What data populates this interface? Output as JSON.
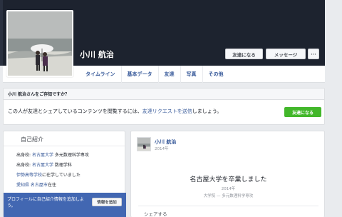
{
  "profile": {
    "name": "小川 航治"
  },
  "cover_actions": {
    "friend_button": "友達になる",
    "message_button": "メッセージ",
    "more_button": "···"
  },
  "nav": {
    "items": [
      {
        "label": "タイムライン"
      },
      {
        "label": "基本データ"
      },
      {
        "label": "友達"
      },
      {
        "label": "写真"
      },
      {
        "label": "その他"
      }
    ]
  },
  "know_card": {
    "header": "小川 航治さんをご存知ですか？",
    "body_prefix": "この人が友達とシェアしているコンテンツを閲覧するには、",
    "body_link": "友達リクエストを送信",
    "body_suffix": "しましょう。",
    "add_friend_button": "友達になる"
  },
  "intro": {
    "title": "自己紹介",
    "lines": [
      {
        "prefix": "出身校: ",
        "link": "名古屋大学",
        "suffix": " 多元数理科学専攻"
      },
      {
        "prefix": "出身校: ",
        "link": "名古屋大学",
        "suffix": " 数理学科"
      },
      {
        "prefix": "",
        "link": "伊勢高等学校",
        "suffix": "に在学していました"
      },
      {
        "prefix": "",
        "link": "愛知県 名古屋市",
        "suffix": "在住"
      }
    ],
    "add_prompt": "プロフィールに自己紹介情報を追加しよう。",
    "add_button": "情報を追加"
  },
  "post": {
    "author": "小川 航治",
    "date": "2014年",
    "event_title": "名古屋大学を卒業しました",
    "event_year": "2014年",
    "event_detail": "大学院 — 多元数理科学専攻",
    "share_label": "シェアする"
  }
}
